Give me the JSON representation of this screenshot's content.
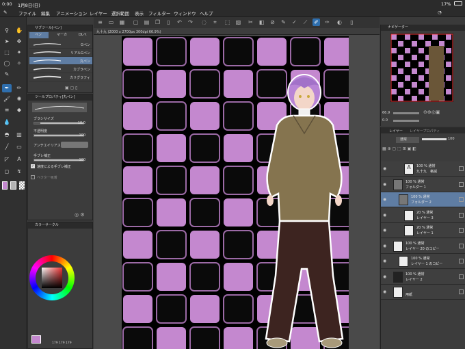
{
  "status": {
    "time": "0:00",
    "date": "1月8日(日)",
    "battery": "17%"
  },
  "menu": [
    "ファイル",
    "編集",
    "アニメーション",
    "レイヤー",
    "選択範囲",
    "表示",
    "フィルター",
    "ウィンドウ",
    "ヘルプ"
  ],
  "doc_tab": "九十九 (2000 x 2700px 300dpi 66.9%)",
  "subtool": {
    "header": "サブツール[ペン]",
    "tabs": [
      "ペン",
      "マーカ",
      "DLペ"
    ],
    "pens": [
      "Gペン",
      "リアルGペン",
      "丸ペン",
      "カブラペン",
      "カリグラフィ"
    ],
    "selected_index": 2
  },
  "tool_property": {
    "header": "ツールプロパティ[丸ペン]",
    "brush_size_label": "ブラシサイズ",
    "brush_size": "10.0",
    "opacity_label": "不透明度",
    "opacity": "100",
    "aa_label": "アンチエイリアス",
    "stabilize_label": "手ブレ補正",
    "stabilize": "100",
    "speed_stabilize_label": "速度による手ブレ補正",
    "vector_label": "ベクター吸着"
  },
  "color_panel": {
    "header": "カラーサークル",
    "values": "179  179  179"
  },
  "navigator": {
    "header": "ナビゲーター",
    "zoom": "66.9",
    "angle": "0.0"
  },
  "layers": {
    "tabs": [
      "レイヤー",
      "レイヤープロパティ"
    ],
    "blend": "通常",
    "opacity": "100",
    "items": [
      {
        "top": "100 % 通常",
        "name": "九十九　格減",
        "indent": 3,
        "kind": "text"
      },
      {
        "top": "100 % 通常",
        "name": "フォルダー 1",
        "indent": 1,
        "kind": "folder"
      },
      {
        "top": "100 % 通常",
        "name": "フォルダー 2",
        "indent": 2,
        "kind": "folder",
        "selected": true
      },
      {
        "top": "20 % 通常",
        "name": "レイヤー 3",
        "indent": 3,
        "kind": "raster"
      },
      {
        "top": "20 % 通常",
        "name": "レイヤー 1",
        "indent": 3,
        "kind": "raster"
      },
      {
        "top": "100 % 通常",
        "name": "レイヤー 20 のコピー",
        "indent": 1,
        "kind": "raster"
      },
      {
        "top": "100 % 通常",
        "name": "レイヤー 1 のコピー",
        "indent": 2,
        "kind": "raster"
      },
      {
        "top": "100 % 通常",
        "name": "レイヤー 2",
        "indent": 1,
        "kind": "pattern"
      },
      {
        "top": "",
        "name": "用紙",
        "indent": 1,
        "kind": "paper"
      }
    ]
  },
  "colors": {
    "accent": "#2f6fae",
    "purple": "#c488cf"
  }
}
